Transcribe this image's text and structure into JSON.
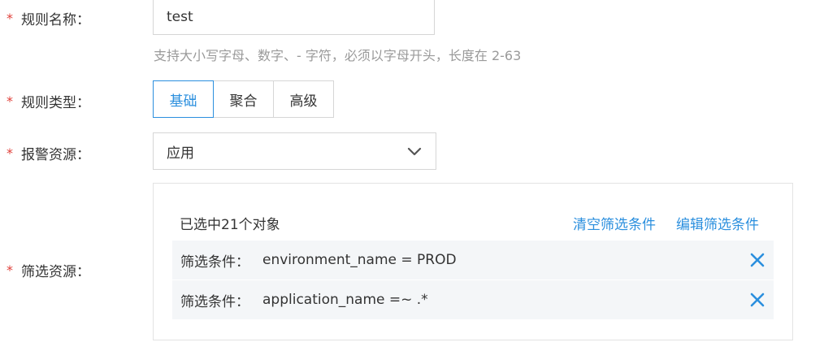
{
  "form": {
    "rule_name": {
      "required_mark": "*",
      "label": "规则名称：",
      "value": "test",
      "hint": "支持大小写字母、数字、- 字符，必须以字母开头，长度在 2-63"
    },
    "rule_type": {
      "required_mark": "*",
      "label": "规则类型：",
      "options": [
        {
          "label": "基础",
          "selected": true
        },
        {
          "label": "聚合",
          "selected": false
        },
        {
          "label": "高级",
          "selected": false
        }
      ]
    },
    "alert_resource": {
      "required_mark": "*",
      "label": "报警资源：",
      "selected": "应用"
    },
    "filter_resource": {
      "required_mark": "*",
      "label": "筛选资源：",
      "selected_count_text": "已选中21个对象",
      "clear_link": "清空筛选条件",
      "edit_link": "编辑筛选条件",
      "conditions": [
        {
          "label": "筛选条件：",
          "expression": "environment_name = PROD"
        },
        {
          "label": "筛选条件：",
          "expression": "application_name =~ .*"
        }
      ]
    }
  },
  "colors": {
    "accent": "#2b8fde",
    "required": "#e0403a",
    "hint": "#9a9a9a",
    "border": "#d6d6d6"
  },
  "icons": {
    "select_chevron": "chevron-down-icon",
    "remove_condition": "close-icon"
  }
}
